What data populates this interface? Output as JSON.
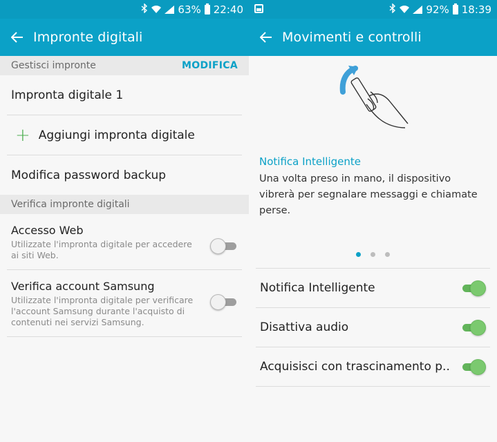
{
  "left": {
    "status": {
      "battery": "63%",
      "time": "22:40"
    },
    "title": "Impronte digitali",
    "section1": {
      "title": "Gestisci impronte",
      "action": "MODIFICA"
    },
    "fingerprint1": "Impronta digitale 1",
    "add_label": "Aggiungi impronta digitale",
    "backup_label": "Modifica password backup",
    "section2": {
      "title": "Verifica impronte digitali"
    },
    "web": {
      "label": "Accesso Web",
      "desc": "Utilizzate l'impronta digitale per accedere ai siti Web.",
      "enabled": false
    },
    "samsung": {
      "label": "Verifica account Samsung",
      "desc": "Utilizzate l'impronta digitale per verificare l'account Samsung durante l'acquisto di contenuti nei servizi Samsung.",
      "enabled": false
    }
  },
  "right": {
    "status": {
      "battery": "92%",
      "time": "18:39"
    },
    "title": "Movimenti e controlli",
    "info": {
      "heading": "Notifica Intelligente",
      "body": "Una volta preso in mano, il dispositivo vibrerà per segnalare messaggi e chiamate perse."
    },
    "pager": {
      "count": 3,
      "active": 1
    },
    "items": [
      {
        "label": "Notifica Intelligente",
        "enabled": true
      },
      {
        "label": "Disattiva audio",
        "enabled": true
      },
      {
        "label": "Acquisisci con trascinamento p..",
        "enabled": true
      }
    ]
  },
  "colors": {
    "primary": "#0ba1c7",
    "status_bar": "#0a9bc0",
    "toggle_on": "#7bc96f",
    "add_plus": "#4caf50"
  }
}
